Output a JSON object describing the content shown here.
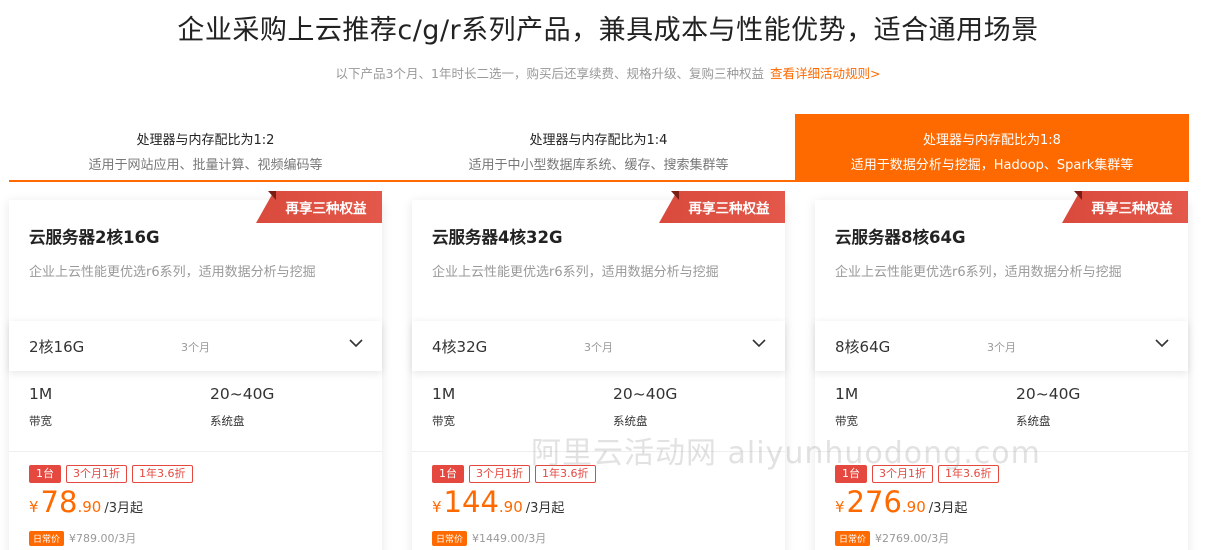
{
  "header": {
    "title": "企业采购上云推荐c/g/r系列产品，兼具成本与性能优势，适合通用场景",
    "subtitle": "以下产品3个月、1年时长二选一，购买后还享续费、规格升级、复购三种权益",
    "rules_link": "查看详细活动规则>"
  },
  "tabs": [
    {
      "title": "处理器与内存配比为1:2",
      "desc": "适用于网站应用、批量计算、视频编码等",
      "active": false
    },
    {
      "title": "处理器与内存配比为1:4",
      "desc": "适用于中小型数据库系统、缓存、搜索集群等",
      "active": false
    },
    {
      "title": "处理器与内存配比为1:8",
      "desc": "适用于数据分析与挖掘，Hadoop、Spark集群等",
      "active": true
    }
  ],
  "cards": [
    {
      "ribbon": "再享三种权益",
      "title": "云服务器2核16G",
      "desc": "企业上云性能更优选r6系列，适用数据分析与挖掘",
      "spec": "2核16G",
      "duration": "3个月",
      "bandwidth_value": "1M",
      "bandwidth_label": "带宽",
      "disk_value": "20~40G",
      "disk_label": "系统盘",
      "tags": [
        "1台",
        "3个月1折",
        "1年3.6折"
      ],
      "price_symbol": "¥",
      "price_int": "78",
      "price_dec": ".90",
      "price_unit": "/3月起",
      "orig_badge": "日常价",
      "orig_price": "¥789.00/3月"
    },
    {
      "ribbon": "再享三种权益",
      "title": "云服务器4核32G",
      "desc": "企业上云性能更优选r6系列，适用数据分析与挖掘",
      "spec": "4核32G",
      "duration": "3个月",
      "bandwidth_value": "1M",
      "bandwidth_label": "带宽",
      "disk_value": "20~40G",
      "disk_label": "系统盘",
      "tags": [
        "1台",
        "3个月1折",
        "1年3.6折"
      ],
      "price_symbol": "¥",
      "price_int": "144",
      "price_dec": ".90",
      "price_unit": "/3月起",
      "orig_badge": "日常价",
      "orig_price": "¥1449.00/3月"
    },
    {
      "ribbon": "再享三种权益",
      "title": "云服务器8核64G",
      "desc": "企业上云性能更优选r6系列，适用数据分析与挖掘",
      "spec": "8核64G",
      "duration": "3个月",
      "bandwidth_value": "1M",
      "bandwidth_label": "带宽",
      "disk_value": "20~40G",
      "disk_label": "系统盘",
      "tags": [
        "1台",
        "3个月1折",
        "1年3.6折"
      ],
      "price_symbol": "¥",
      "price_int": "276",
      "price_dec": ".90",
      "price_unit": "/3月起",
      "orig_badge": "日常价",
      "orig_price": "¥2769.00/3月"
    }
  ],
  "watermark": "阿里云活动网 aliyunhuodong.com",
  "colors": {
    "accent": "#ff6a00",
    "ribbon": "#e3584a",
    "tag": "#e5483f"
  }
}
